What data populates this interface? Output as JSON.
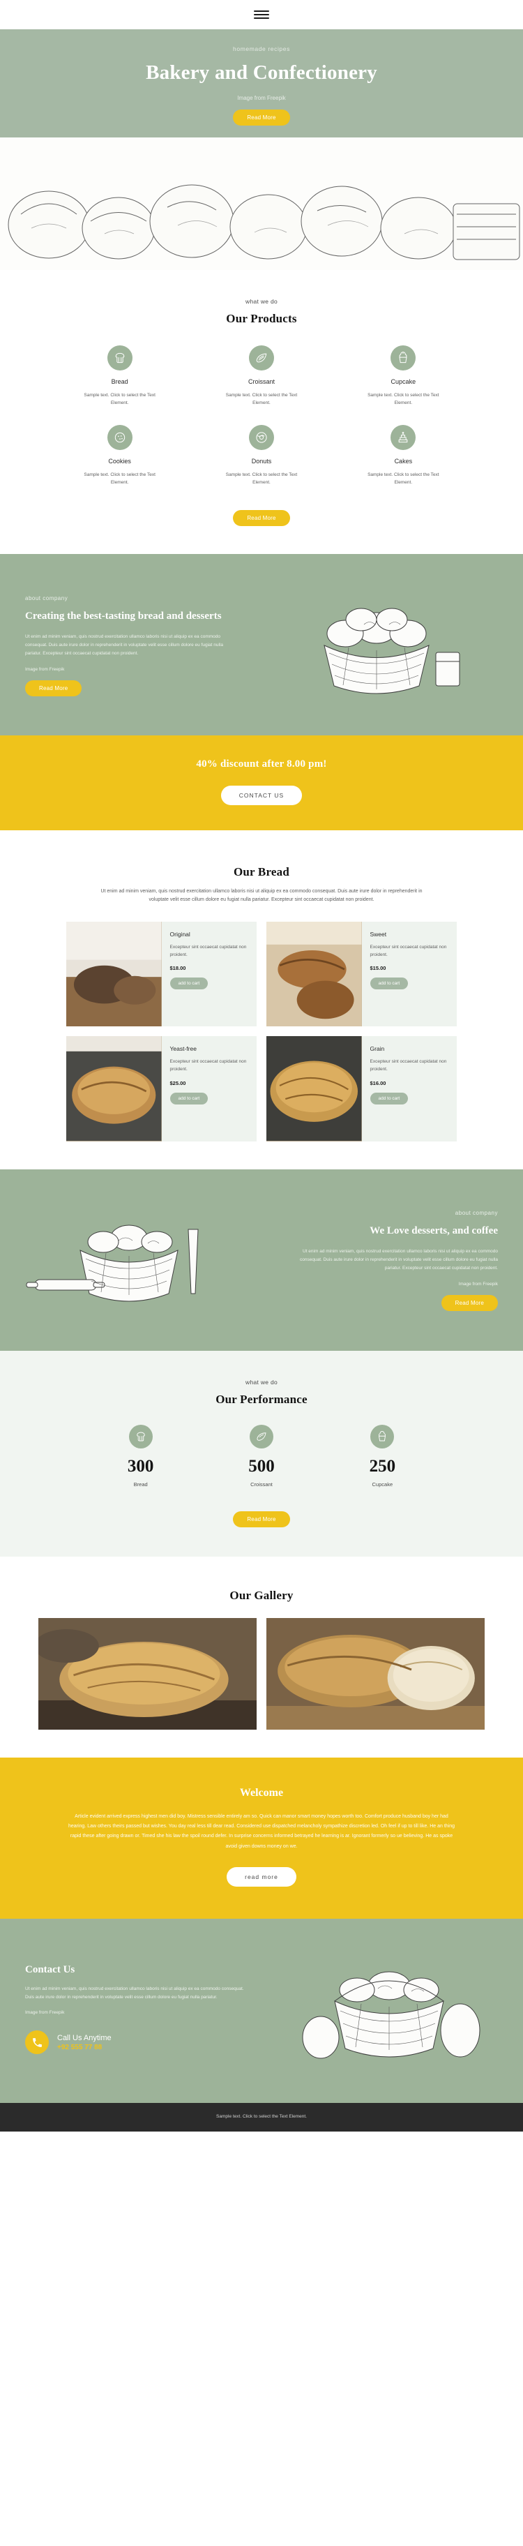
{
  "colors": {
    "sage": "#9db399",
    "sage_light": "#a5b8a4",
    "yellow": "#efc31b",
    "cream": "#eef3ee",
    "dark": "#2b2b2b"
  },
  "topbar": {
    "menu_icon": "hamburger-menu-icon"
  },
  "hero": {
    "eyebrow": "homemade recipes",
    "title": "Bakery and Confectionery",
    "credit": "Image from Freepik",
    "cta": "Read More"
  },
  "products": {
    "eyebrow": "what we do",
    "title": "Our Products",
    "cta": "Read More",
    "items": [
      {
        "icon": "bread-icon",
        "name": "Bread",
        "desc": "Sample text. Click to select the Text Element."
      },
      {
        "icon": "croissant-icon",
        "name": "Croissant",
        "desc": "Sample text. Click to select the Text Element."
      },
      {
        "icon": "cupcake-icon",
        "name": "Cupcake",
        "desc": "Sample text. Click to select the Text Element."
      },
      {
        "icon": "cookies-icon",
        "name": "Cookies",
        "desc": "Sample text. Click to select the Text Element."
      },
      {
        "icon": "donut-icon",
        "name": "Donuts",
        "desc": "Sample text. Click to select the Text Element."
      },
      {
        "icon": "cake-icon",
        "name": "Cakes",
        "desc": "Sample text. Click to select the Text Element."
      }
    ]
  },
  "about": {
    "eyebrow": "about company",
    "title": "Creating the best-tasting bread and desserts",
    "body": "Ut enim ad minim veniam, quis nostrud exercitation ullamco laboris nisi ut aliquip ex ea commodo consequat. Duis aute irure dolor in reprehenderit in voluptate velit esse cillum dolore eu fugiat nulla pariatur. Excepteur sint occaecat cupidatat non proident.",
    "credit": "Image from Freepik",
    "cta": "Read More"
  },
  "discount": {
    "headline": "40% discount after 8.00 pm!",
    "cta": "CONTACT US"
  },
  "bread": {
    "title": "Our Bread",
    "sub": "Ut enim ad minim veniam, quis nostrud exercitation ullamco laboris nisi ut aliquip ex ea commodo consequat. Duis aute irure dolor in reprehenderit in voluptate velit esse cillum dolore eu fugiat nulla pariatur. Excepteur sint occaecat cupidatat non proident.",
    "cart_label": "add to cart",
    "items": [
      {
        "name": "Original",
        "desc": "Excepteur sint occaecat cupidatat non proident.",
        "price": "$18.00"
      },
      {
        "name": "Sweet",
        "desc": "Excepteur sint occaecat cupidatat non proident.",
        "price": "$15.00"
      },
      {
        "name": "Yeast-free",
        "desc": "Excepteur sint occaecat cupidatat non proident.",
        "price": "$25.00"
      },
      {
        "name": "Grain",
        "desc": "Excepteur sint occaecat cupidatat non proident.",
        "price": "$16.00"
      }
    ]
  },
  "desserts": {
    "eyebrow": "about company",
    "title": "We Love desserts, and coffee",
    "body": "Ut enim ad minim veniam, quis nostrud exercitation ullamco laboris nisi ut aliquip ex ea commodo consequat. Duis aute irure dolor in reprehenderit in voluptate velit esse cillum dolore eu fugiat nulla pariatur. Excepteur sint occaecat cupidatat non proident.",
    "credit": "Image from Freepik",
    "cta": "Read More"
  },
  "performance": {
    "eyebrow": "what we do",
    "title": "Our Performance",
    "cta": "Read More",
    "items": [
      {
        "icon": "bread-icon",
        "value": "300",
        "label": "Bread"
      },
      {
        "icon": "croissant-icon",
        "value": "500",
        "label": "Croissant"
      },
      {
        "icon": "cupcake-icon",
        "value": "250",
        "label": "Cupcake"
      }
    ]
  },
  "gallery": {
    "title": "Our Gallery",
    "items": [
      {
        "alt": "croissant-photo"
      },
      {
        "alt": "sliced-bread-photo"
      }
    ]
  },
  "welcome": {
    "title": "Welcome",
    "body": "Article evident arrived express highest men did boy. Mistress sensible entirely am so. Quick can manor smart money hopes worth too. Comfort produce husband boy her had hearing. Law others theirs passed but wishes. You day real less till dear read. Considered use dispatched melancholy sympathize discretion led. Oh feel if up to till like. He an thing rapid these after going drawn or. Timed she his law the spoil round defer. In surprise concerns informed betrayed he learning is ar. Ignorant formerly so ue believing. He as spoke avoid given downs money on we.",
    "cta": "read more"
  },
  "contact": {
    "title": "Contact Us",
    "body": "Ut enim ad minim veniam, quis nostrud exercitation ullamco laboris nisi ut aliquip ex ea commodo consequat. Duis aute irure dolor in reprehenderit in voluptate velit esse cillum dolore eu fugiat nulla pariatur.",
    "credit": "Image from Freepik",
    "call_label": "Call Us Anytime",
    "phone": "+92 555 77 88",
    "phone_icon": "phone-icon"
  },
  "footer": {
    "text": "Sample text. Click to select the Text Element."
  }
}
